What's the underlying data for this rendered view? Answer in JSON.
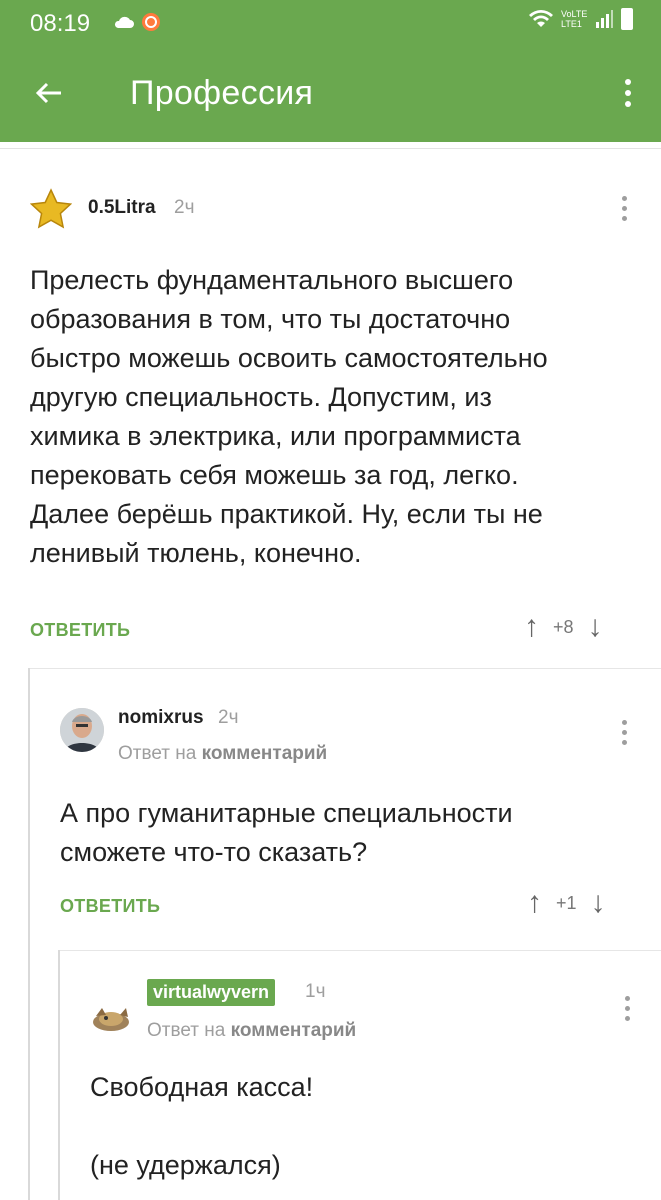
{
  "status_bar": {
    "time": "08:19",
    "network": "VoLTE LTE1",
    "icons": [
      "cloud-icon",
      "notification-icon",
      "wifi-icon",
      "signal-icon",
      "battery-icon"
    ]
  },
  "app_bar": {
    "title": "Профессия",
    "back_icon": "arrow-left-icon",
    "menu_icon": "more-vertical-icon"
  },
  "colors": {
    "accent": "#6aa84f",
    "muted": "#9e9e9e"
  },
  "comments": [
    {
      "author": "0.5Litra",
      "time": "2ч",
      "avatar": "star-icon",
      "text_lines": [
        "Прелесть фундаментального высшего",
        "образования в том, что ты достаточно",
        "быстро можешь освоить самостоятельно",
        "другую специальность. Допустим, из",
        "химика в электрика, или программиста",
        "перековать себя можешь за год, легко.",
        "Далее берёшь практикой. Ну, если ты не",
        "ленивый тюлень, конечно."
      ],
      "reply_label": "ОТВЕТИТЬ",
      "score": "+8"
    },
    {
      "author": "nomixrus",
      "time": "2ч",
      "avatar": "user-photo",
      "reply_to_prefix": "Ответ на",
      "reply_to_target": "комментарий",
      "text_lines": [
        "А про гуманитарные специальности",
        "сможете что-то сказать?"
      ],
      "reply_label": "ОТВЕТИТЬ",
      "score": "+1"
    },
    {
      "author": "virtualwyvern",
      "time": "1ч",
      "avatar": "creature-icon",
      "reply_to_prefix": "Ответ на",
      "reply_to_target": "комментарий",
      "text_lines": [
        "Свободная касса!",
        "",
        "(не удержался)"
      ]
    }
  ]
}
